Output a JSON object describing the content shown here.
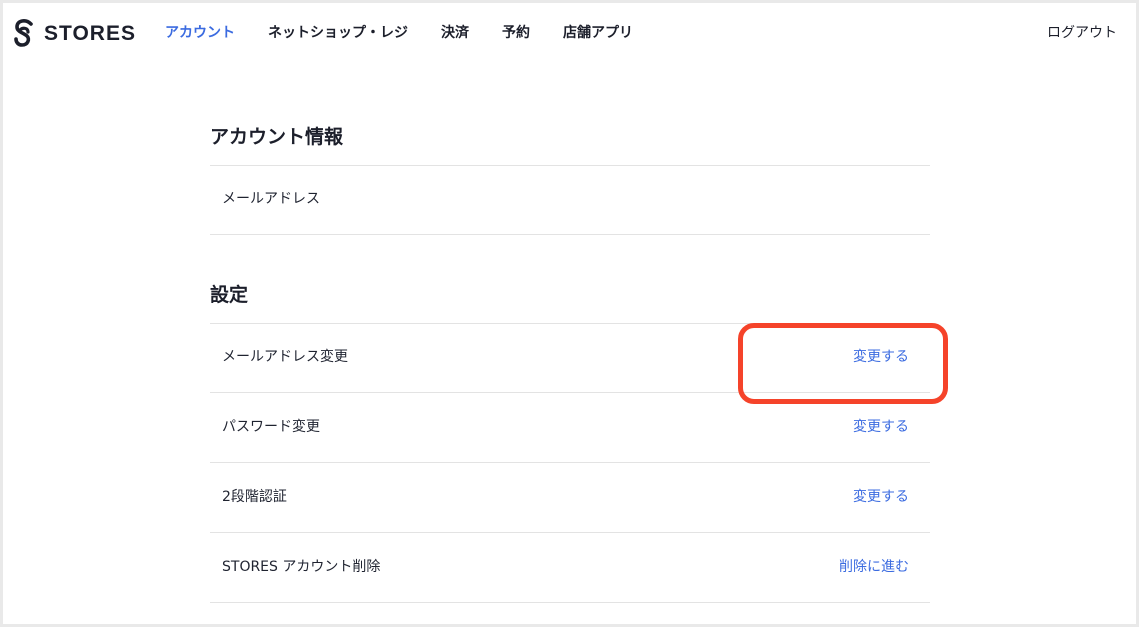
{
  "brand": {
    "name": "STORES",
    "logo_icon": "stores-logo-icon"
  },
  "nav": {
    "items": [
      {
        "label": "アカウント",
        "active": true
      },
      {
        "label": "ネットショップ・レジ",
        "active": false
      },
      {
        "label": "決済",
        "active": false
      },
      {
        "label": "予約",
        "active": false
      },
      {
        "label": "店舗アプリ",
        "active": false
      }
    ],
    "logout_label": "ログアウト"
  },
  "account_info": {
    "title": "アカウント情報",
    "email_label": "メールアドレス"
  },
  "settings": {
    "title": "設定",
    "rows": [
      {
        "label": "メールアドレス変更",
        "action": "変更する"
      },
      {
        "label": "パスワード変更",
        "action": "変更する"
      },
      {
        "label": "2段階認証",
        "action": "変更する"
      },
      {
        "label": "STORES アカウント削除",
        "action": "削除に進む"
      }
    ]
  },
  "colors": {
    "accent": "#3b6be0",
    "highlight": "#f5432a",
    "text": "#1f2330"
  }
}
